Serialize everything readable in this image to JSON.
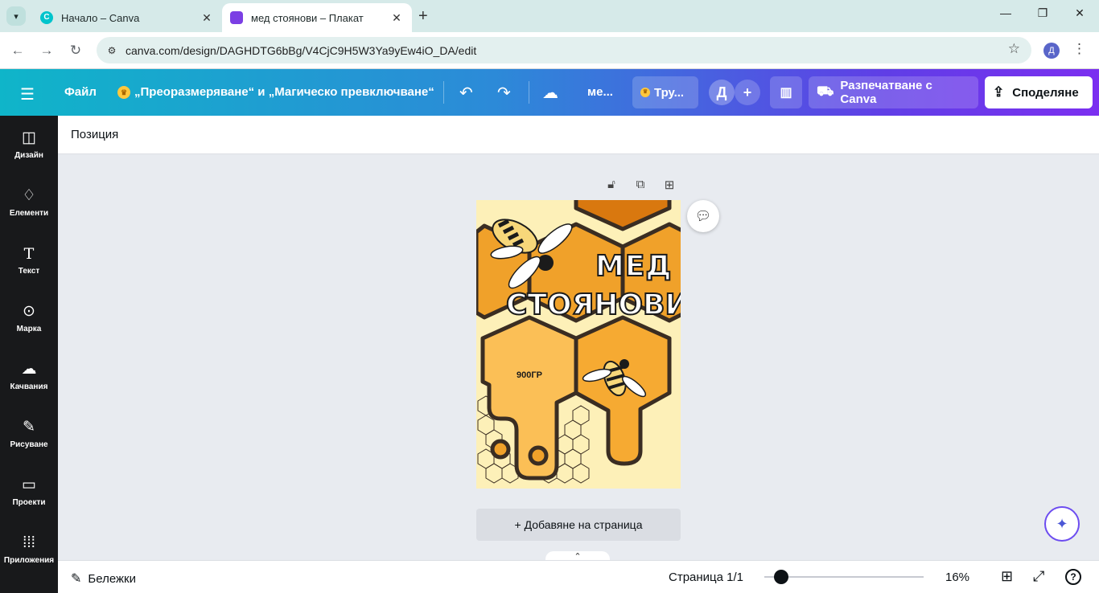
{
  "browser": {
    "tabs": [
      {
        "title": "Начало – Canva",
        "active": false,
        "favicon_color": "#00c4cc"
      },
      {
        "title": "мед стоянови – Плакат",
        "active": true,
        "favicon_color": "#7b3fe4"
      }
    ],
    "new_tab_glyph": "+",
    "url": "canva.com/design/DAGHDTG6bBg/V4CjC9H5W3Ya9yEw4iO_DA/edit",
    "profile_initial": "Д"
  },
  "header": {
    "file_label": "Файл",
    "resize_label": "„Преоразмеряване“ и „Магическо превключване“",
    "doc_title": "ме...",
    "try_label": "Тру...",
    "avatar_initial": "Д",
    "print_label": "Разпечатване с Canva",
    "share_label": "Споделяне",
    "colors": {
      "gradient_start": "#0fb5c9",
      "gradient_end": "#7b2ff0"
    }
  },
  "sidebar": {
    "items": [
      {
        "label": "Дизайн",
        "icon": "design-icon"
      },
      {
        "label": "Елементи",
        "icon": "elements-icon"
      },
      {
        "label": "Текст",
        "icon": "text-icon"
      },
      {
        "label": "Марка",
        "icon": "brand-icon"
      },
      {
        "label": "Качвания",
        "icon": "uploads-icon"
      },
      {
        "label": "Рисуване",
        "icon": "draw-icon"
      },
      {
        "label": "Проекти",
        "icon": "projects-icon"
      },
      {
        "label": "Приложения",
        "icon": "apps-icon"
      }
    ]
  },
  "context_bar": {
    "position_label": "Позиция"
  },
  "poster": {
    "title_line1": "МЕД",
    "title_line2": "СТОЯНОВИ",
    "weight_label": "900ГР",
    "colors": {
      "background": "#fdf0b8",
      "honey_light": "#fbbf56",
      "honey_mid": "#f0a12a",
      "honey_dark": "#d9780f",
      "outline": "#3a2d22"
    }
  },
  "canvas": {
    "add_page_label": "+ Добавяне на страница"
  },
  "footer": {
    "notes_label": "Бележки",
    "page_label": "Страница 1/1",
    "zoom_label": "16%",
    "zoom_value": 16,
    "help_glyph": "?"
  }
}
